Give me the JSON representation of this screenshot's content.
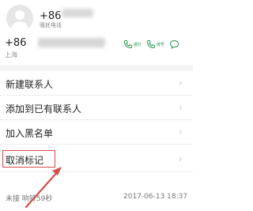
{
  "contact": {
    "name_prefix": "+86",
    "tag": "骚扰电话",
    "number_prefix": "+86",
    "region": "上海"
  },
  "actions": [
    {
      "label": "拨打",
      "icon": "phone-icon"
    },
    {
      "label": "拨号",
      "icon": "phone-dial-icon"
    },
    {
      "label": "",
      "icon": "message-icon"
    }
  ],
  "menu": [
    {
      "label": "新建联系人"
    },
    {
      "label": "添加到已有联系人"
    },
    {
      "label": "加入黑名单"
    },
    {
      "label": "取消标记"
    }
  ],
  "call_record": {
    "status": "未接 响铃59秒",
    "time": "2017-06-13 18:37"
  },
  "colors": {
    "accent_green": "#2a9a50",
    "highlight_red": "#d84a4a"
  }
}
